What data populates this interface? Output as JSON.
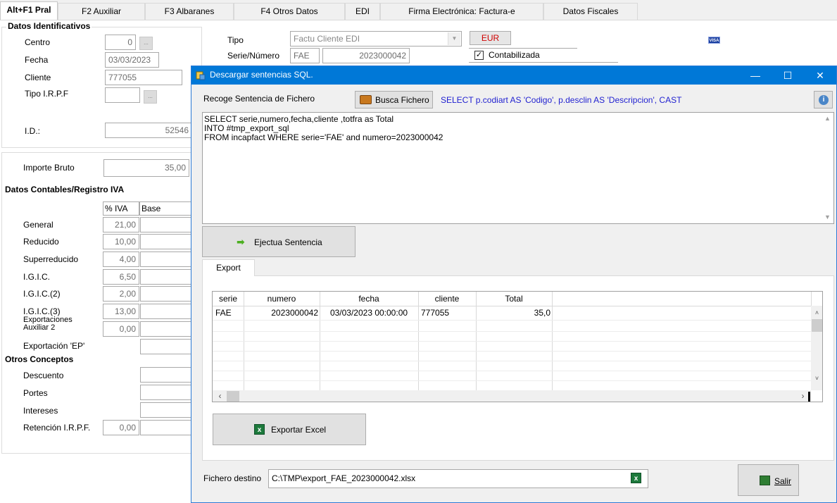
{
  "tabs": [
    "Alt+F1 Pral",
    "F2 Auxiliar",
    "F3 Albaranes",
    "F4 Otros Datos",
    "EDI",
    "Firma Electrónica: Factura-e",
    "Datos Fiscales"
  ],
  "ident": {
    "group_title": "Datos Identificativos",
    "centro_label": "Centro",
    "centro_value": "0",
    "fecha_label": "Fecha",
    "fecha_value": "03/03/2023",
    "cliente_label": "Cliente",
    "cliente_value": "777055",
    "tipo_irpf_label": "Tipo I.R.P.F",
    "id_label": "I.D.:",
    "id_value": "52546",
    "tipo_label": "Tipo",
    "tipo_value": "Factu Cliente EDI",
    "serie_label": "Serie/Número",
    "serie_value": "FAE",
    "numero_value": "2023000042",
    "currency": "EUR",
    "contabilizada_label": "Contabilizada",
    "visa": "VISA"
  },
  "importes": {
    "importe_bruto_label": "Importe Bruto",
    "importe_bruto_value": "35,00",
    "contables_title": "Datos Contables/Registro IVA",
    "col_iva": "% IVA",
    "col_base": "Base",
    "rows": [
      {
        "label": "General",
        "iva": "21,00"
      },
      {
        "label": "Reducido",
        "iva": "10,00"
      },
      {
        "label": "Superreducido",
        "iva": "4,00"
      },
      {
        "label": "I.G.I.C.",
        "iva": "6,50"
      },
      {
        "label": "I.G.I.C.(2)",
        "iva": "2,00"
      },
      {
        "label": "I.G.I.C.(3)",
        "iva": "13,00"
      },
      {
        "label": "Exportaciones Auxiliar 2",
        "iva": "0,00"
      }
    ],
    "exportacion_ep_label": "Exportación 'EP'",
    "otros_title": "Otros Conceptos",
    "descuento_label": "Descuento",
    "portes_label": "Portes",
    "intereses_label": "Intereses",
    "retencion_label": "Retención I.R.P.F.",
    "retencion_value": "0,00"
  },
  "dialog": {
    "title": "Descargar sentencias SQL.",
    "recoge_label": "Recoge Sentencia de Fichero",
    "busca_button": "Busca Fichero",
    "sql_preview": "SELECT p.codiart AS 'Codigo', p.desclin AS 'Descripcion', CAST",
    "sql_lines": [
      "SELECT serie,numero,fecha,cliente ,totfra as Total",
      "INTO #tmp_export_sql",
      "FROM incapfact WHERE serie='FAE' and numero=2023000042"
    ],
    "ejecuta_button": "Ejectua Sentencia",
    "export_tab": "Export",
    "grid": {
      "columns": [
        "serie",
        "numero",
        "fecha",
        "cliente",
        "Total"
      ],
      "rows": [
        [
          "FAE",
          "2023000042",
          "03/03/2023 00:00:00",
          "777055",
          "35,0"
        ]
      ]
    },
    "exportar_button": "Exportar Excel",
    "fichero_label": "Fichero destino",
    "fichero_value": "C:\\TMP\\export_FAE_2023000042.xlsx",
    "salir_button": "Salir"
  }
}
